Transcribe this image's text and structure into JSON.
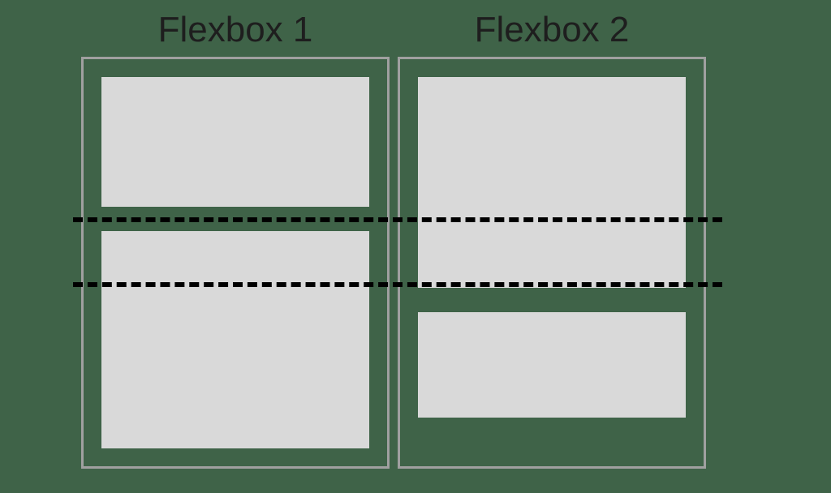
{
  "titles": {
    "left": "Flexbox 1",
    "right": "Flexbox 2"
  }
}
